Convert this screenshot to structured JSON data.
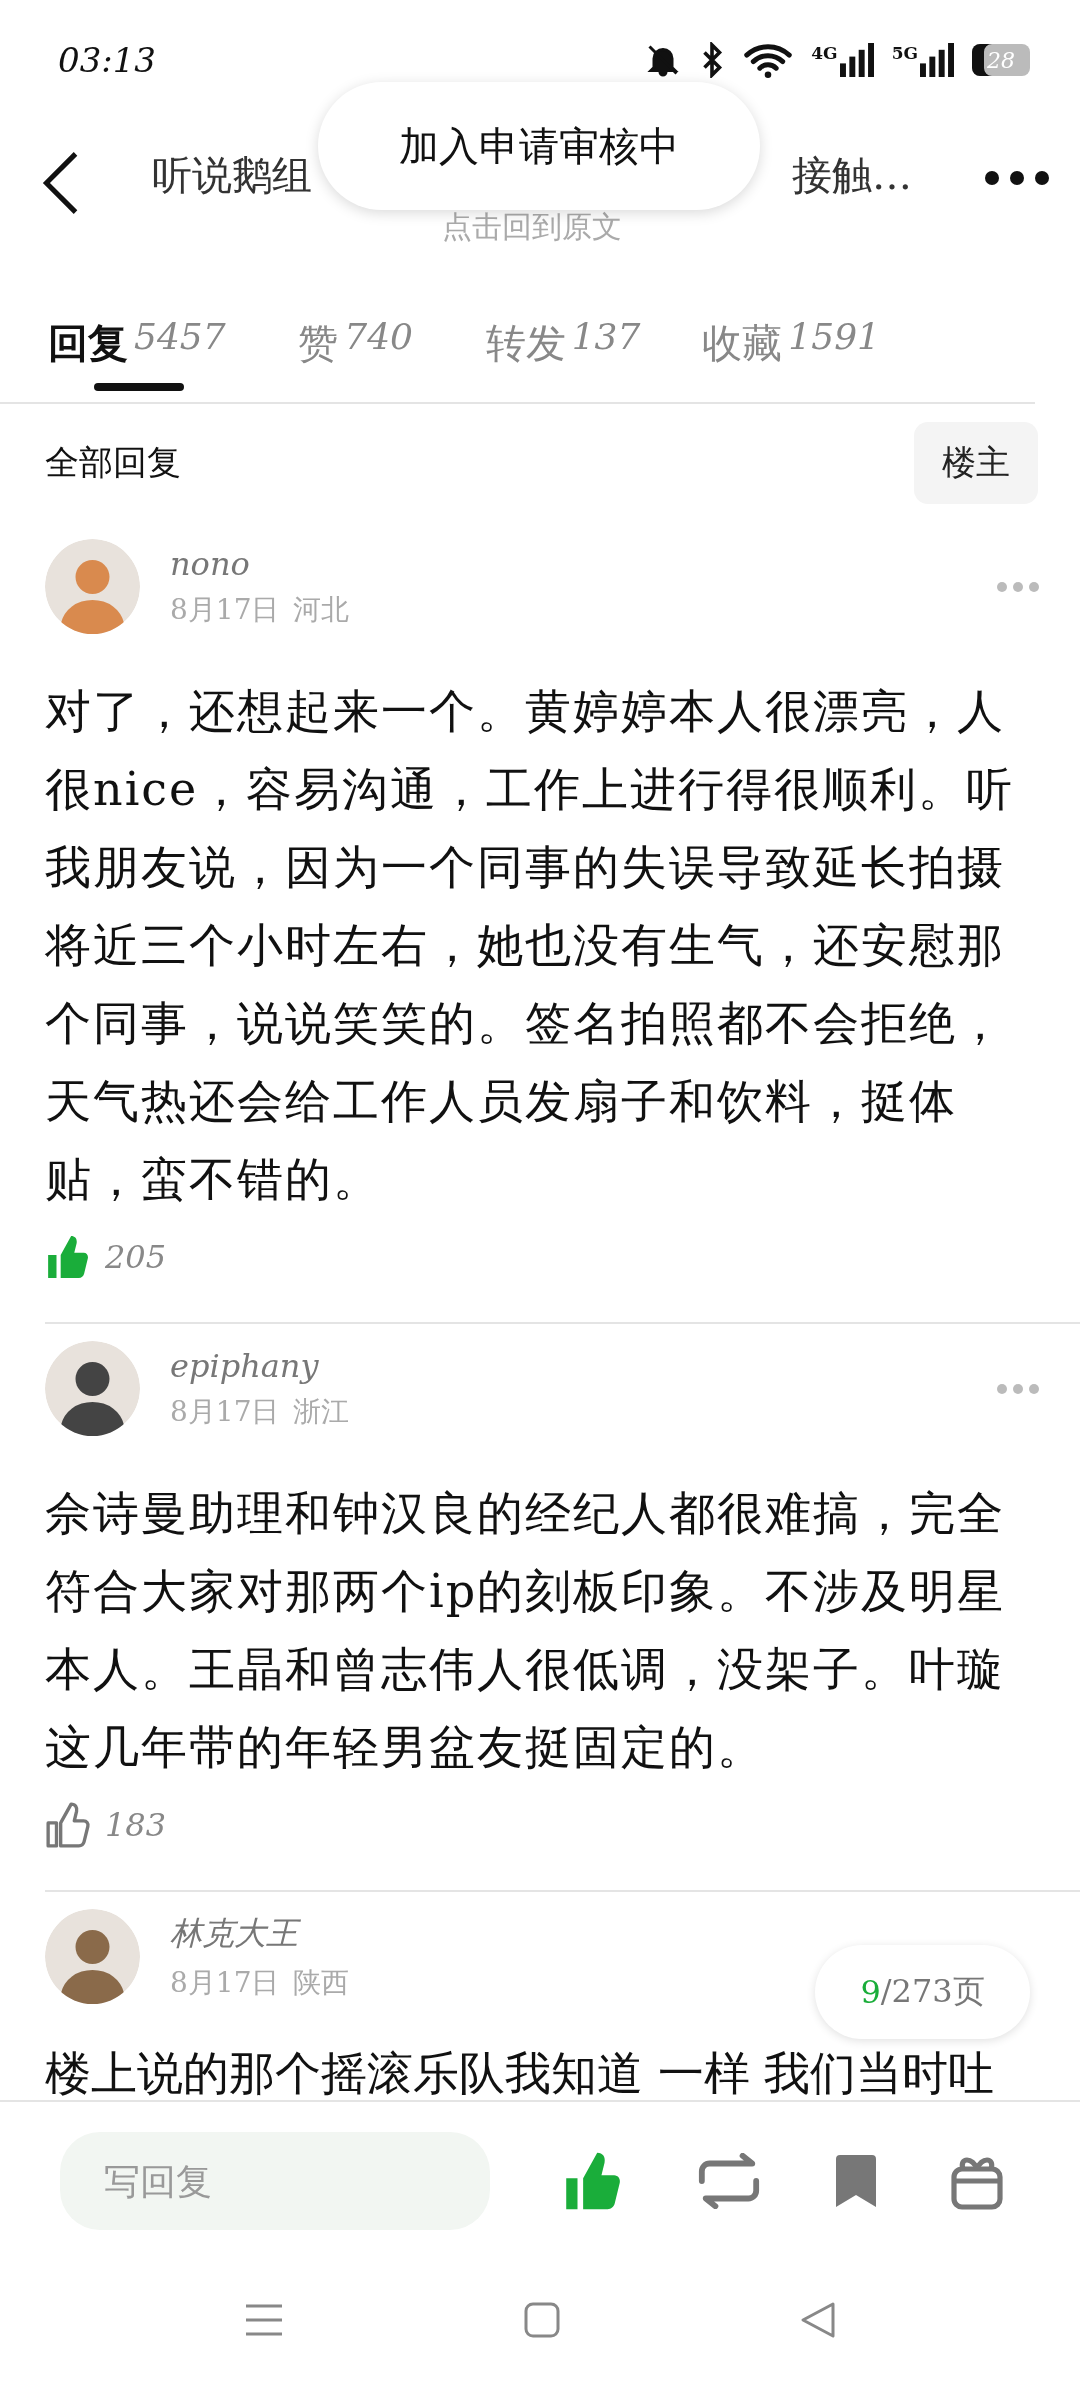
{
  "status_bar": {
    "time": "03:13",
    "network_4g": "4G",
    "network_5g": "5G",
    "battery": "28"
  },
  "header": {
    "title_start": "听说鹅组",
    "title_end": "接触…",
    "subtitle": "点击回到原文"
  },
  "toast": "加入申请审核中",
  "tabs": [
    {
      "label": "回复",
      "count": "5457",
      "selected": true
    },
    {
      "label": "赞",
      "count": "740",
      "selected": false
    },
    {
      "label": "转发",
      "count": "137",
      "selected": false
    },
    {
      "label": "收藏",
      "count": "1591",
      "selected": false
    }
  ],
  "filter": {
    "label": "全部回复",
    "button": "楼主"
  },
  "comments": [
    {
      "user": "nono",
      "date": "8月17日",
      "region": "河北",
      "text": "对了，还想起来一个。黄婷婷本人很漂亮，人很nice，容易沟通，工作上进行得很顺利。听我朋友说，因为一个同事的失误导致延长拍摄将近三个小时左右，她也没有生气，还安慰那个同事，说说笑笑的。签名拍照都不会拒绝，天气热还会给工作人员发扇子和饮料，挺体贴，蛮不错的。",
      "likes": "205",
      "liked": true
    },
    {
      "user": "epiphany",
      "date": "8月17日",
      "region": "浙江",
      "text": "佘诗曼助理和钟汉良的经纪人都很难搞，完全符合大家对那两个ip的刻板印象。不涉及明星本人。王晶和曾志伟人很低调，没架子。叶璇这几年带的年轻男盆友挺固定的。",
      "likes": "183",
      "liked": false
    },
    {
      "user": "林克大王",
      "date": "8月17日",
      "region": "陕西",
      "text": "楼上说的那个摇滚乐队我知道 一样 我们当时吐"
    }
  ],
  "page_indicator": {
    "current": "9",
    "total": "/273页"
  },
  "bottom_bar": {
    "placeholder": "写回复",
    "liked": true
  }
}
